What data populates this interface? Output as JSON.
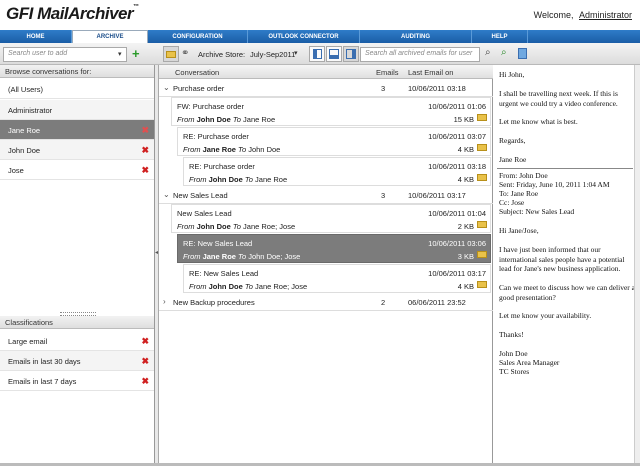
{
  "header": {
    "logo_brand": "GFI",
    "logo_product": "MailArchiver",
    "logo_tm": "™",
    "welcome_text": "Welcome,",
    "username": "Administrator"
  },
  "nav": {
    "tabs": [
      {
        "label": "HOME"
      },
      {
        "label": "ARCHIVE"
      },
      {
        "label": "CONFIGURATION"
      },
      {
        "label": "OUTLOOK CONNECTOR"
      },
      {
        "label": "AUDITING"
      },
      {
        "label": "HELP"
      }
    ],
    "active_tab": "ARCHIVE"
  },
  "toolbar": {
    "user_search_placeholder": "Search user to add",
    "archive_store_label": "Archive Store:",
    "archive_store_value": "July-Sep2011",
    "email_search_placeholder": "Search all archived emails for user"
  },
  "left": {
    "browse_header": "Browse conversations for:",
    "users": [
      {
        "label": "(All Users)",
        "removable": false,
        "selected": false
      },
      {
        "label": "Administrator",
        "removable": false,
        "selected": false
      },
      {
        "label": "Jane Roe",
        "removable": true,
        "selected": true
      },
      {
        "label": "John Doe",
        "removable": true,
        "selected": false
      },
      {
        "label": "Jose",
        "removable": true,
        "selected": false
      }
    ],
    "classifications_header": "Classifications",
    "classifications": [
      {
        "label": "Large email"
      },
      {
        "label": "Emails in last 30 days"
      },
      {
        "label": "Emails in last 7 days"
      }
    ]
  },
  "columns": {
    "conversation": "Conversation",
    "emails": "Emails",
    "last_email": "Last Email on"
  },
  "conversations": [
    {
      "name": "Purchase order",
      "count": "3",
      "date": "10/06/2011 03:18",
      "expanded": true,
      "messages": [
        {
          "subject": "FW: Purchase order",
          "date": "10/06/2011 01:06",
          "from_label": "From",
          "from": "John Doe",
          "to_label": "To",
          "to": "Jane Roe",
          "size": "15 KB",
          "selected": false
        },
        {
          "subject": "RE: Purchase order",
          "date": "10/06/2011 03:07",
          "from_label": "From",
          "from": "Jane Roe",
          "to_label": "To",
          "to": "John Doe",
          "size": "4 KB",
          "selected": false
        },
        {
          "subject": "RE: Purchase order",
          "date": "10/06/2011 03:18",
          "from_label": "From",
          "from": "John Doe",
          "to_label": "To",
          "to": "Jane Roe",
          "size": "4 KB",
          "selected": false
        }
      ]
    },
    {
      "name": "New Sales Lead",
      "count": "3",
      "date": "10/06/2011 03:17",
      "expanded": true,
      "messages": [
        {
          "subject": "New Sales Lead",
          "date": "10/06/2011 01:04",
          "from_label": "From",
          "from": "John Doe",
          "to_label": "To",
          "to": "Jane Roe; Jose",
          "size": "2 KB",
          "selected": false
        },
        {
          "subject": "RE: New Sales Lead",
          "date": "10/06/2011 03:06",
          "from_label": "From",
          "from": "Jane Roe",
          "to_label": "To",
          "to": "John Doe; Jose",
          "size": "3 KB",
          "selected": true
        },
        {
          "subject": "RE: New Sales Lead",
          "date": "10/06/2011 03:17",
          "from_label": "From",
          "from": "John Doe",
          "to_label": "To",
          "to": "Jane Roe; Jose",
          "size": "4 KB",
          "selected": false
        }
      ]
    },
    {
      "name": "New Backup procedures",
      "count": "2",
      "date": "06/06/2011 23:52",
      "expanded": false,
      "messages": []
    }
  ],
  "preview": {
    "p1": "Hi John,",
    "p2": "I shall be travelling next week. If this is urgent we could try a video conference.",
    "p3": "Let me know what is best.",
    "p4": "Regards,",
    "p5": "Jane Roe",
    "q_from": "From: John Doe",
    "q_sent": "Sent: Friday, June 10, 2011 1:04 AM",
    "q_to": "To: Jane Roe",
    "q_cc": "Cc: Jose",
    "q_subject": "Subject: New Sales Lead",
    "q1": "Hi Jane/Jose,",
    "q2": "I have just been informed that our international sales people have a potential lead for Jane's new business application.",
    "q3": "Can we meet to discuss how we can deliver a good presentation?",
    "q4": "Let me know your availability.",
    "q5": "Thanks!",
    "sig1": "John Doe",
    "sig2": "Sales Area Manager",
    "sig3": "TC Stores"
  }
}
